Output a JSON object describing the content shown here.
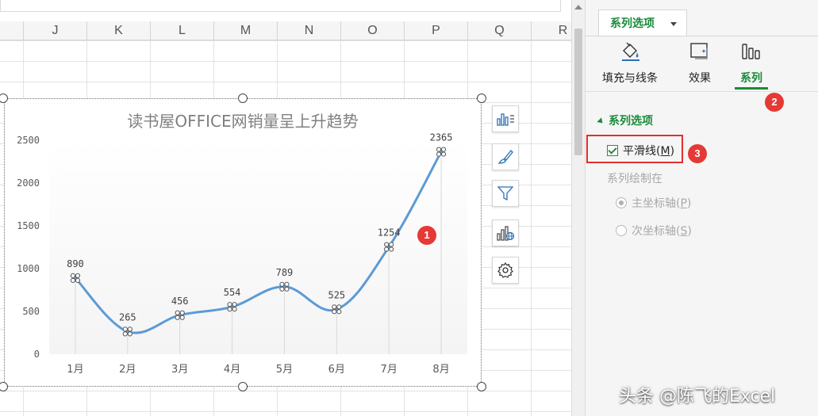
{
  "spreadsheet": {
    "columns": [
      "J",
      "K",
      "L",
      "M",
      "N",
      "O",
      "P",
      "Q",
      "R"
    ]
  },
  "chart_data": {
    "type": "line",
    "title": "读书屋OFFICE网销量呈上升趋势",
    "categories": [
      "1月",
      "2月",
      "3月",
      "4月",
      "5月",
      "6月",
      "7月",
      "8月"
    ],
    "series": [
      {
        "values": [
          890,
          265,
          456,
          554,
          789,
          525,
          1254,
          2365
        ]
      }
    ],
    "y_ticks": [
      "0",
      "500",
      "1000",
      "1500",
      "2000",
      "2500"
    ],
    "ylim": [
      0,
      2500
    ],
    "smooth": true,
    "data_labels": true,
    "grid": false,
    "legend": "none",
    "colors": {
      "line": "#5b9bd5",
      "plot_area": "#f4f4f4"
    }
  },
  "chart_tools": [
    "chart-elements-icon",
    "chart-style-icon",
    "chart-filter-icon",
    "chart-settings-chart-icon",
    "gear-icon"
  ],
  "pane": {
    "tab_label": "系列选项",
    "icon_tabs": [
      {
        "label": "填充与线条",
        "icon": "paint-bucket-icon"
      },
      {
        "label": "效果",
        "icon": "effects-icon"
      },
      {
        "label": "系列",
        "icon": "series-bars-icon"
      }
    ],
    "section_title": "系列选项",
    "smooth_line_label": "平滑线(",
    "smooth_line_key": "M",
    "smooth_line_suffix": ")",
    "plot_on_label": "系列绘制在",
    "primary_axis_label": "主坐标轴(",
    "primary_axis_key": "P",
    "secondary_axis_label": "次坐标轴(",
    "secondary_axis_key": "S",
    "close_paren": ")",
    "accent_color": "#1a8a3a"
  },
  "badges": [
    "1",
    "2",
    "3"
  ],
  "watermark": "头条 @陈飞的Excel"
}
